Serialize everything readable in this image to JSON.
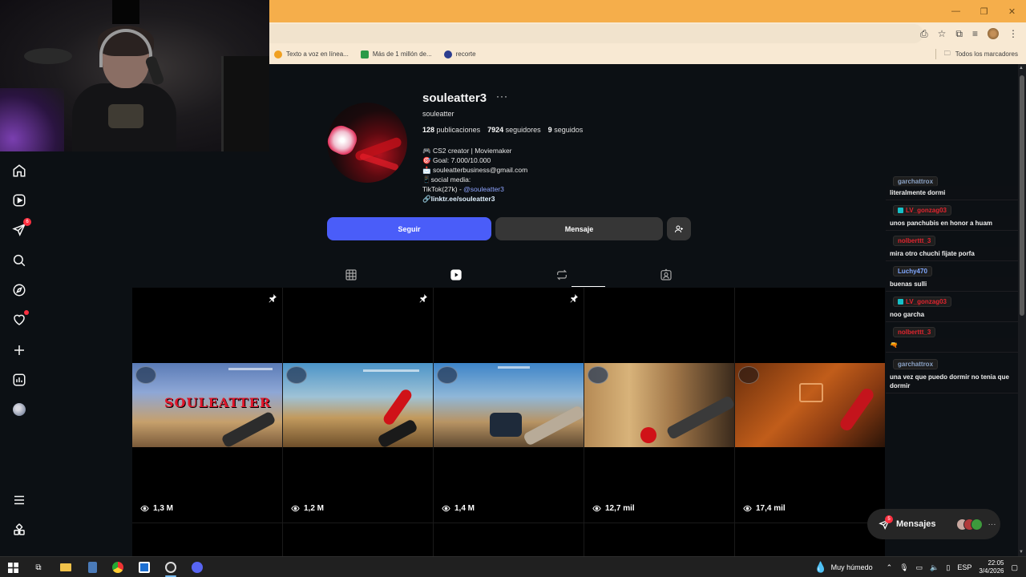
{
  "browser": {
    "bookmarks": [
      {
        "label": "Texto a voz en línea...",
        "color": "#f0a020"
      },
      {
        "label": "Más de 1 millón de...",
        "color": "#2b9a48"
      },
      {
        "label": "recorte",
        "color": "#2c3d8f"
      }
    ],
    "all_bookmarks_label": "Todos los marcadores"
  },
  "profile": {
    "username": "souleatter3",
    "more": "···",
    "name": "souleatter",
    "stats": [
      {
        "value": "128",
        "label": "publicaciones"
      },
      {
        "value": "7924",
        "label": "seguidores"
      },
      {
        "value": "9",
        "label": "seguidos"
      }
    ],
    "bio": {
      "line1": "🎮 CS2 creator | Moviemaker",
      "line2": "🎯 Goal: 7.000/10.000",
      "line3": "📩 souleatterbusiness@gmail.com",
      "line4": "📱social media:",
      "tiktok_prefix": "TikTok(27k) - ",
      "tiktok_handle": "@souleatter3",
      "external_link": "linktr.ee/souleatter3"
    },
    "follow_label": "Seguir",
    "message_label": "Mensaje"
  },
  "reels": [
    {
      "views": "1,3 M",
      "pinned": true
    },
    {
      "views": "1,2 M",
      "pinned": true
    },
    {
      "views": "1,4 M",
      "pinned": true
    },
    {
      "views": "12,7 mil",
      "pinned": false
    },
    {
      "views": "17,4 mil",
      "pinned": false
    }
  ],
  "reel1_overlay_text": "SOULEATTER",
  "chat": {
    "messages": [
      {
        "user": "garchattrox",
        "text": "literalmente dormi",
        "color": "gray",
        "icon": false
      },
      {
        "user": "LV_gonzag03",
        "text": "unos panchubis en honor a huam",
        "color": "red",
        "icon": true
      },
      {
        "user": "nolberttt_3",
        "text": "mira otro chuchi fijate porfa",
        "color": "red",
        "icon": false
      },
      {
        "user": "Luchy470",
        "text": "buenas sulli",
        "color": "blue",
        "icon": false
      },
      {
        "user": "LV_gonzag03",
        "text": "noo garcha",
        "color": "red",
        "icon": true
      },
      {
        "user": "nolberttt_3",
        "text": "🔫",
        "color": "red",
        "icon": false
      },
      {
        "user": "garchattrox",
        "text": "una vez que puedo dormir no tenia que dormir",
        "color": "gray",
        "icon": false
      }
    ]
  },
  "messages_pill": {
    "label": "Mensajes",
    "badge": "5",
    "more": "···"
  },
  "nav": {
    "notif_badge": "6"
  },
  "taskbar": {
    "weather": "Muy húmedo",
    "lang": "ESP",
    "time": "22:05",
    "date": "3/4/2026"
  }
}
